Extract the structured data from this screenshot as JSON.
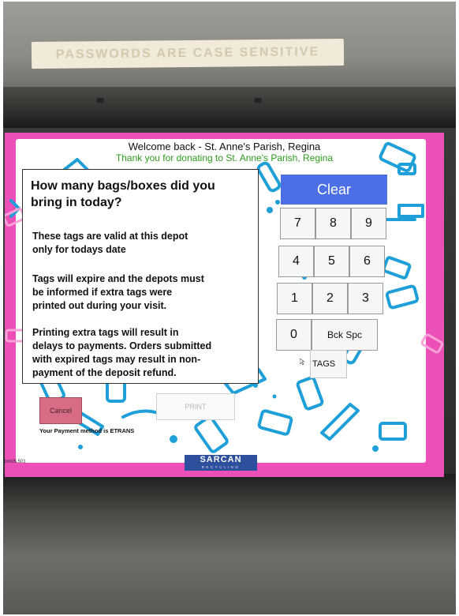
{
  "colors": {
    "screen_magenta": "#ec4fb8",
    "clear_blue": "#4d6fe6",
    "thanks_green": "#2e9b1e",
    "cancel_pink": "#d86c84",
    "logo_blue": "#2e4f9b",
    "deco_blue": "#1f9fd8"
  },
  "sticker": {
    "text": "PASSWORDS ARE CASE SENSITIVE"
  },
  "header": {
    "welcome": "Welcome back - St. Anne's Parish, Regina",
    "thanks": "Thank you for donating to St. Anne's Parish, Regina"
  },
  "info": {
    "question_line1": "How many bags/boxes did you",
    "question_line2": "bring in today?",
    "para1_line1": "These tags are valid at this depot",
    "para1_line2": "only for todays date",
    "para2_line1": "Tags will expire and the depots must",
    "para2_line2": "be informed if extra tags were",
    "para2_line3": "printed out during your visit.",
    "para3_line1": "Printing extra tags will result in",
    "para3_line2": "delays to payments. Orders submitted",
    "para3_line3": "with expired tags may result in non-",
    "para3_line4": "payment of the deposit refund."
  },
  "keypad": {
    "clear": "Clear",
    "k7": "7",
    "k8": "8",
    "k9": "9",
    "k4": "4",
    "k5": "5",
    "k6": "6",
    "k1": "1",
    "k2": "2",
    "k3": "3",
    "k0": "0",
    "backspace": "Bck Spc",
    "tags": "TAGS"
  },
  "actions": {
    "cancel": "Cancel",
    "print": "PRINT"
  },
  "footer": {
    "payment": "Your Payment method is ETRANS",
    "version": "bm05.501",
    "logo_brand": "SARCAN",
    "logo_sub": "RECYCLING"
  }
}
